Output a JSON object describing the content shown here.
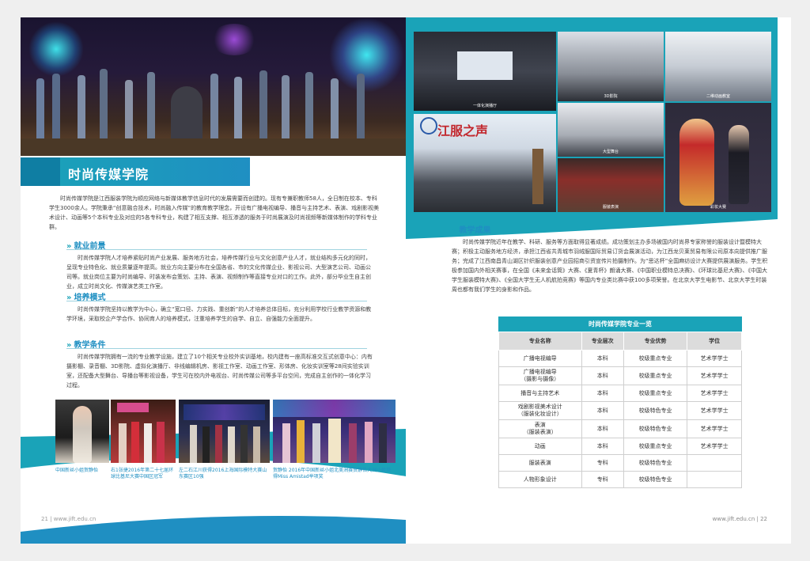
{
  "left_page": {
    "title": "时尚传媒学院",
    "intro": "时尚传媒学院是江西服装学院为顺应网络与新媒体教学信息时代的发展需要而创建的。现有专兼职教师58人，全日制在校本、专科学生3000余人。学院秉承“创意融合技术，时尚融入传媒”的教育教学理念，开设有广播电视编导、播音与主持艺术、表演、戏剧影视美术设计、动画等5个本科专业及对应的5各专科专业，构建了相互支撑、相互渗透的服务于时尚展演及时尚视频等新媒体制作的学科专业群。",
    "sections": [
      {
        "heading": "就业前景",
        "text": "时尚传媒学院人才培养紧贴时尚产业发展、服务地方社会，培养传媒行业与文化创意产业人才，就业结构多元化的同时，呈现专业特色化、就业质量逐年提高。就业方向主要分布在全国各省、市的文化传媒企业、影视公司、大型演艺公司、动画公司等。就业岗位主要为时尚编导、时装发布会策划、主持、表演、视频制作等直接专业对口的工作。此外，部分毕业生自主创业，成立时尚文化、传媒演艺类工作室。"
      },
      {
        "heading": "培养模式",
        "text": "时尚传媒学院坚持以教学为中心，确立“宽口径、力实践、重创新”的人才培养总体目标，充分利用学校行业教学资源和教学环境，采取校企产学合作、协同育人的培养模式，注重培养学生的自学、自立、自强能力全面提升。"
      },
      {
        "heading": "教学条件",
        "text": "时尚传媒学院拥有一流的专业教学设施，建立了10个相关专业校外实训基地，校内建有一座高标准交互式创意中心：内有摄影棚、录音棚、3D影院、虚拟化演播厅、非线编辑机房、影视工作室、动画工作室、形体房、化妆实训室等28间实验实训室，还配备大型舞台、导播台等影视设备，学生可在校内外电视台、时尚传媒公司等多平台空间，完成自主创作的一体化学习过程。"
      }
    ],
    "captions": [
      "中国新丝小姐贺静怡",
      "右1张捷2016年第二十七届环球比基尼大赛中国区冠军",
      "左二石江川获得2016上海国际模特大赛山东赛区10强",
      "贺静怡 2016年中国新丝小姐北美洲赛贺静怡大洲小姐获得Miss Amistad举项奖"
    ],
    "footer": "21  |  www.jift.edu.cn"
  },
  "right_page": {
    "photo_tags": [
      "一体化演播厅",
      "3D影院",
      "二维动画教室",
      "大型舞台",
      "实训工作室",
      "服装表演",
      "彩妆大赛"
    ],
    "banner_text": "江服之声",
    "section_heading": "教学成果",
    "section_text": "时尚传媒学院近年在教学、科研、服务等方面取得显著成绩。成功策划主办多场被国内时尚界专家称誉的服装设计暨模特大赛；积极主动服务地方经济，承担江西省共青城市羽绒服国际贸易订货会展演活动，为江西龙贝莱贸易有限公司原本向提供推广服务；完成了江西南昌青山湖区针织服装创意产业园招商引资宣传片拍摄制作。为“思达杯”全国麻纺设计大赛提供展演服务。学生积极参加国内外相关赛事，在全国《未来金话筒》大赛、《夏青杯》朗诵大赛、《中国职业模特总决赛》、《环球比基尼大赛》、《中国大学生服装模特大赛》、《全国大学生无人机航拍竞赛》等国内专业类比赛中获100多项荣誉。在北京大学生电影节、北京大学生时装周也都有我们学生的身影和作品。",
    "table": {
      "caption": "时尚传媒学院专业一览",
      "headers": [
        "专业名称",
        "专业层次",
        "专业优势",
        "学位"
      ],
      "rows": [
        [
          "广播电视编导",
          "本科",
          "校级重点专业",
          "艺术学学士"
        ],
        [
          "广播电视编导\n（摄影与摄像）",
          "本科",
          "校级重点专业",
          "艺术学学士"
        ],
        [
          "播音与主持艺术",
          "本科",
          "校级重点专业",
          "艺术学学士"
        ],
        [
          "戏剧影视美术设计\n（服装化妆设计）",
          "本科",
          "校级特色专业",
          "艺术学学士"
        ],
        [
          "表演\n（服装表演）",
          "本科",
          "校级特色专业",
          "艺术学学士"
        ],
        [
          "动画",
          "本科",
          "校级重点专业",
          "艺术学学士"
        ],
        [
          "服装表演",
          "专科",
          "校级特色专业",
          ""
        ],
        [
          "人物形象设计",
          "专科",
          "校级特色专业",
          ""
        ]
      ]
    },
    "footer": "www.jift.edu.cn  |  22"
  },
  "colors": {
    "accent": "#1aa3b8",
    "accent_dark": "#1f8fc2",
    "table_header": "#dcdcdc"
  }
}
